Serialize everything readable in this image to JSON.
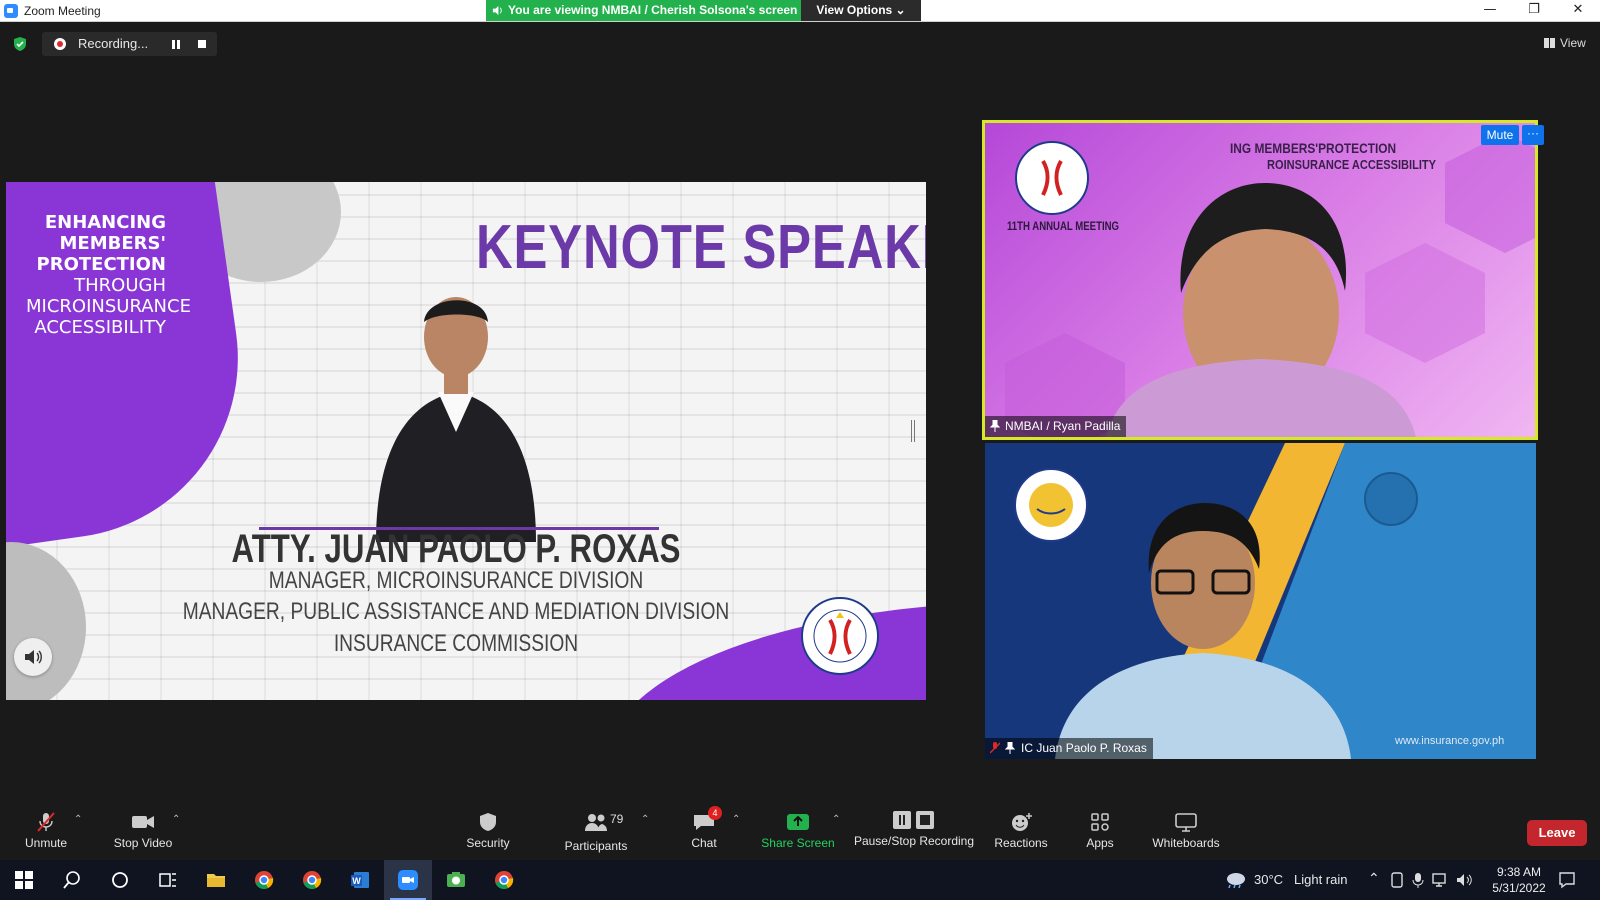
{
  "window": {
    "title": "Zoom Meeting",
    "minimize": "—",
    "restore": "❐",
    "close": "✕"
  },
  "share_banner": {
    "text": "You are viewing NMBAI / Cherish Solsona's screen",
    "view_options": "View Options ⌄"
  },
  "recording": {
    "label": "Recording..."
  },
  "view_button": "View",
  "slide": {
    "theme_lines": [
      {
        "text": "ENHANCING",
        "bold": true
      },
      {
        "text": "MEMBERS'",
        "bold": true
      },
      {
        "text": "PROTECTION",
        "bold": true
      },
      {
        "text": "THROUGH",
        "bold": false
      },
      {
        "text": "MICROINSURANCE",
        "bold": false
      },
      {
        "text": "ACCESSIBILITY",
        "bold": false
      }
    ],
    "heading": "KEYNOTE SPEAKER",
    "speaker_name": "ATTY. JUAN PAOLO P. ROXAS",
    "role_1": "MANAGER, MICROINSURANCE DIVISION",
    "role_2": "MANAGER, PUBLIC ASSISTANCE AND MEDIATION DIVISION",
    "org": "INSURANCE COMMISSION"
  },
  "participants": [
    {
      "name": "NMBAI / Ryan Padilla",
      "bg_text_1": "ING MEMBERS'PROTECTION",
      "bg_text_2": "ROINSURANCE ACCESSIBILITY",
      "bg_text_3": "11TH ANNUAL MEETING",
      "mute_label": "Mute",
      "more_label": "···"
    },
    {
      "name": "IC Juan Paolo P. Roxas",
      "bg_url": "www.insurance.gov.ph"
    }
  ],
  "toolbar": {
    "unmute": "Unmute",
    "stop_video": "Stop Video",
    "security": "Security",
    "participants": "Participants",
    "participant_count": "79",
    "chat": "Chat",
    "chat_badge": "4",
    "share_screen": "Share Screen",
    "pause_stop_recording": "Pause/Stop Recording",
    "reactions": "Reactions",
    "apps": "Apps",
    "whiteboards": "Whiteboards",
    "leave": "Leave"
  },
  "taskbar": {
    "weather_temp": "30°C",
    "weather_desc": "Light rain",
    "time": "9:38 AM",
    "date": "5/31/2022"
  },
  "colors": {
    "share_green": "#23b14d",
    "leave_red": "#c3262c",
    "zoom_blue": "#0e72ed",
    "active_speaker": "#d7e825",
    "slide_purple": "#6b3aa8"
  }
}
